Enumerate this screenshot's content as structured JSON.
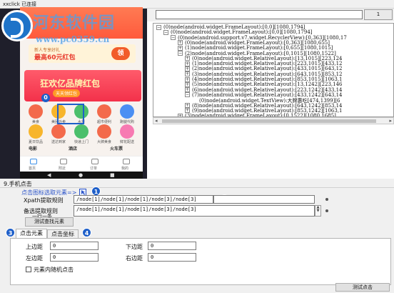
{
  "window": {
    "title": "xxclick 已连接"
  },
  "phone_preview": {
    "watermark": {
      "site": "河东软件园",
      "url": "www.pc0359.cn"
    },
    "banner_small": {
      "line1": "新人专享好礼",
      "line2": "最高60元红包",
      "button": "领"
    },
    "banner_big": {
      "title": "狂欢亿品牌红包",
      "sub": "天天领红包"
    },
    "selected_marker": "0",
    "icon_grid": [
      {
        "label": "美食",
        "color": "#f36a4b"
      },
      {
        "label": "美团外卖",
        "color": "#f7b52c"
      },
      {
        "label": "水果",
        "color": "#4bbf6b"
      },
      {
        "label": "超市便利",
        "color": "#f36a4b"
      },
      {
        "label": "跑腿代购",
        "color": "#4b8ff3"
      },
      {
        "label": "夏日饮品",
        "color": "#f7b52c"
      },
      {
        "label": "送达到家",
        "color": "#f36a4b"
      },
      {
        "label": "快递上门",
        "color": "#4bbf6b"
      },
      {
        "label": "大牌美食",
        "color": "#f36a4b"
      },
      {
        "label": "鲜花配送",
        "color": "#f77ab2"
      }
    ],
    "categories": [
      "电影",
      "酒店",
      "火车票"
    ],
    "tab_bar": [
      "首页",
      "附近",
      "订单",
      "我的"
    ],
    "nav_glyphs": [
      "◀",
      "●",
      "■"
    ]
  },
  "tree": {
    "search_value": "",
    "button_label": "1",
    "nodes": [
      {
        "indent": 0,
        "expander": "⊟",
        "text": "(0)node(android.widget.FrameLayout):[0,0][1080,1794]"
      },
      {
        "indent": 1,
        "expander": "⊟",
        "text": "(0)node(android.widget.FrameLayout):[0,0][1080,1794]"
      },
      {
        "indent": 2,
        "expander": "⊟",
        "text": "(0)node(android.support.v7.widget.RecyclerView):[0,363][1080,17"
      },
      {
        "indent": 3,
        "expander": "⊞",
        "text": "(0)node(android.widget.FrameLayout):[0,363][1080,655]"
      },
      {
        "indent": 3,
        "expander": "⊞",
        "text": "(1)node(android.widget.FrameLayout):[0,655][1080,1015]"
      },
      {
        "indent": 3,
        "expander": "⊟",
        "text": "(2)node(android.widget.FrameLayout):[0,1015][1080,1522]"
      },
      {
        "indent": 4,
        "expander": "⊞",
        "text": "(0)node(android.widget.RelativeLayout):[13,1015][223,124"
      },
      {
        "indent": 4,
        "expander": "⊞",
        "text": "(1)node(android.widget.RelativeLayout):[223,1015][433,12"
      },
      {
        "indent": 4,
        "expander": "⊞",
        "text": "(2)node(android.widget.RelativeLayout):[433,1015][643,12"
      },
      {
        "indent": 4,
        "expander": "⊞",
        "text": "(3)node(android.widget.RelativeLayout):[643,1015][853,12"
      },
      {
        "indent": 4,
        "expander": "⊞",
        "text": "(4)node(android.widget.RelativeLayout):[853,1015][1063,1"
      },
      {
        "indent": 4,
        "expander": "⊞",
        "text": "(5)node(android.widget.RelativeLayout):[13,1242][223,146"
      },
      {
        "indent": 4,
        "expander": "⊞",
        "text": "(6)node(android.widget.RelativeLayout):[223,1242][433,14"
      },
      {
        "indent": 4,
        "expander": "⊟",
        "text": "(7)node(android.widget.RelativeLayout):[433,1242][643,14"
      },
      {
        "indent": 5,
        "expander": "",
        "text": "(0)node(android.widget.TextView):大牌惠吃[474,1399][6"
      },
      {
        "indent": 4,
        "expander": "⊞",
        "text": "(8)node(android.widget.RelativeLayout):[643,1242][853,14"
      },
      {
        "indent": 4,
        "expander": "⊞",
        "text": "(9)node(android.widget.RelativeLayout):[853,1242][1063,1"
      },
      {
        "indent": 3,
        "expander": "⊞",
        "text": "(3)node(android.widget.FrameLayout):[0,1522][1080,1685]"
      }
    ]
  },
  "panel": {
    "group_title": "9.手机点击",
    "click_select_link": "点击图标选取元素=>",
    "xpath_label": "Xpath提取规则",
    "xpath_value": "/node[1]/node[1]/node[1]/node[3]/node[3]",
    "backup_label": "备选提取规则",
    "backup_label_overlap": "一行一条",
    "backup_value": "/node[1]/node[1]/node[1]/node[3]/node[3]",
    "test_find_button": "测试查找元素",
    "tabs": [
      "点击元素",
      "点击坐标"
    ],
    "fields": {
      "top_label": "上边距",
      "top_value": "0",
      "bottom_label": "下边距",
      "bottom_value": "0",
      "left_label": "左边距",
      "left_value": "0",
      "right_label": "右边距",
      "right_value": "0"
    },
    "random_click_label": "元素内随机点击",
    "test_click_button": "测试点击",
    "badges": [
      "1",
      "2",
      "3",
      "4"
    ]
  }
}
